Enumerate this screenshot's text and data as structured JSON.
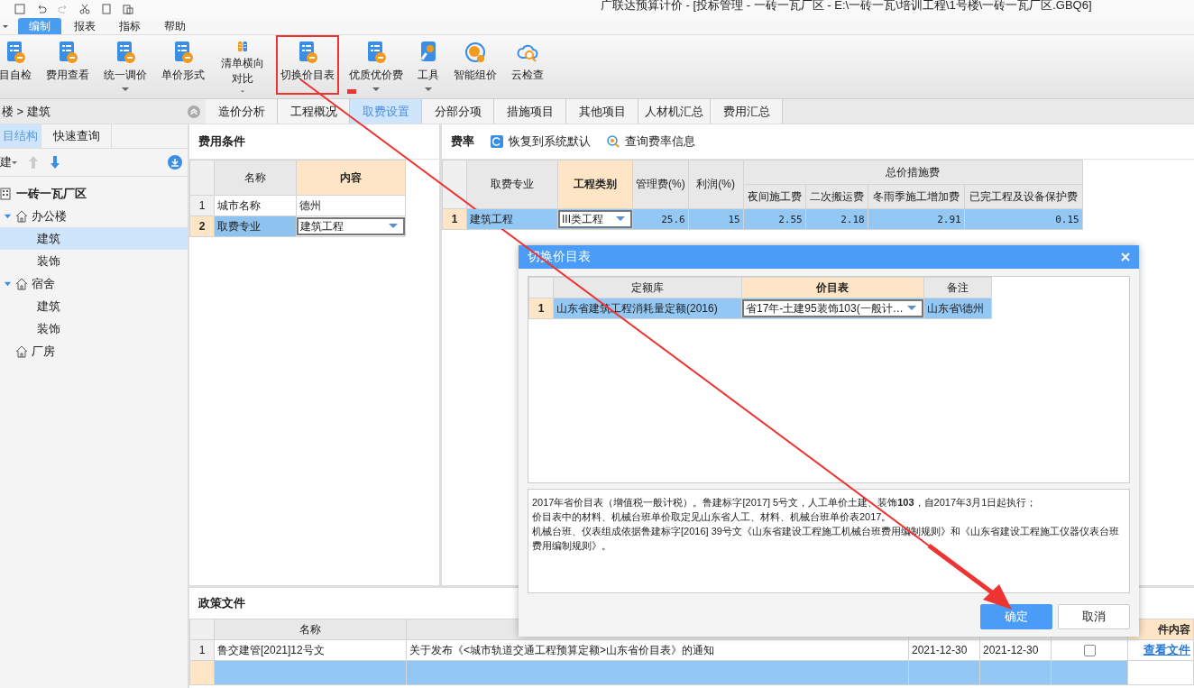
{
  "title_bar": {
    "title": "广联达预算计价 - [投标管理 - 一砖一瓦厂区 - E:\\一砖一瓦\\培训工程\\1号楼\\一砖一瓦厂区.GBQ6]"
  },
  "menu_tabs": [
    {
      "label": "编制",
      "selected": true
    },
    {
      "label": "报表",
      "selected": false
    },
    {
      "label": "指标",
      "selected": false
    },
    {
      "label": "帮助",
      "selected": false
    }
  ],
  "ribbon": [
    {
      "label": "目自检",
      "dropdown": false,
      "highlighted": false
    },
    {
      "label": "费用查看",
      "dropdown": false,
      "highlighted": false
    },
    {
      "label": "统一调价",
      "dropdown": true,
      "highlighted": false
    },
    {
      "label": "单价形式",
      "dropdown": false,
      "highlighted": false
    },
    {
      "label": "清单横向对比",
      "dropdown": true,
      "highlighted": false
    },
    {
      "label": "切换价目表",
      "dropdown": false,
      "highlighted": true
    },
    {
      "label": "优质优价费",
      "dropdown": true,
      "highlighted": false
    },
    {
      "label": "工具",
      "dropdown": true,
      "highlighted": false
    },
    {
      "label": "智能组价",
      "dropdown": false,
      "highlighted": false
    },
    {
      "label": "云检查",
      "dropdown": false,
      "highlighted": false
    }
  ],
  "breadcrumb": "楼 > 建筑",
  "page_tabs": [
    {
      "label": "造价分析",
      "selected": false
    },
    {
      "label": "工程概况",
      "selected": false
    },
    {
      "label": "取费设置",
      "selected": true
    },
    {
      "label": "分部分项",
      "selected": false
    },
    {
      "label": "措施项目",
      "selected": false
    },
    {
      "label": "其他项目",
      "selected": false
    },
    {
      "label": "人材机汇总",
      "selected": false
    },
    {
      "label": "费用汇总",
      "selected": false
    }
  ],
  "sidebar": {
    "tabs": [
      {
        "label": "目结构",
        "selected": true
      },
      {
        "label": "快速查询",
        "selected": false
      }
    ],
    "new_button": "建",
    "tree": [
      {
        "label": "一砖一瓦厂区",
        "kind": "project",
        "selected": false,
        "children": [
          {
            "label": "办公楼",
            "kind": "building",
            "expanded": true,
            "selected": false,
            "children": [
              {
                "label": "建筑",
                "kind": "unit",
                "selected": true
              },
              {
                "label": "装饰",
                "kind": "unit",
                "selected": false
              }
            ]
          },
          {
            "label": "宿舍",
            "kind": "building",
            "expanded": true,
            "selected": false,
            "children": [
              {
                "label": "建筑",
                "kind": "unit",
                "selected": false
              },
              {
                "label": "装饰",
                "kind": "unit",
                "selected": false
              }
            ]
          },
          {
            "label": "厂房",
            "kind": "building",
            "selected": false
          }
        ]
      }
    ]
  },
  "fee_conditions": {
    "title": "费用条件",
    "columns": [
      "名称",
      "内容"
    ],
    "rows": [
      {
        "index": "1",
        "name": "城市名称",
        "value": "德州",
        "kind": "text",
        "selected": false
      },
      {
        "index": "2",
        "name": "取费专业",
        "value": "建筑工程",
        "kind": "dropdown",
        "selected": true
      }
    ]
  },
  "fee_rates": {
    "title": "费率",
    "actions": [
      "恢复到系统默认",
      "查询费率信息"
    ],
    "columns": {
      "specialty": "取费专业",
      "category": "工程类别",
      "management": "管理费(%)",
      "profit": "利润(%)",
      "group": "总价措施费",
      "night": "夜间施工费",
      "secondary": "二次搬运费",
      "winter": "冬雨季施工增加费",
      "protection": "已完工程及设备保护费"
    },
    "rows": [
      {
        "index": "1",
        "specialty": "建筑工程",
        "category": "III类工程",
        "management": "25.6",
        "profit": "15",
        "night": "2.55",
        "secondary": "2.18",
        "winter": "2.91",
        "protection": "0.15",
        "selected": true
      }
    ]
  },
  "policy_files": {
    "title": "政策文件",
    "columns": {
      "name": "名称",
      "file": "件内容"
    },
    "rows": [
      {
        "index": "1",
        "name": "鲁交建管[2021]12号文",
        "title": "关于发布《<城市轨道交通工程预算定额>山东省价目表》的通知",
        "date_1": "2021-12-30",
        "date_2": "2021-12-30",
        "checked": false,
        "link": "查看文件",
        "selected": false
      },
      {
        "selected": true
      }
    ]
  },
  "dialog": {
    "title": "切换价目表",
    "columns": [
      "定额库",
      "价目表",
      "备注"
    ],
    "rows": [
      {
        "index": "1",
        "library": "山东省建筑工程消耗量定额(2016)",
        "price_table": "省17年-土建95装饰103(一般计…",
        "note": "山东省\\德州",
        "selected": true
      }
    ],
    "description": [
      "2017年省价目表（增值税一般计税）。鲁建标字[2017] 5号文，人工单价土建、装饰**103**，自2017年3月1日起执行；",
      "价目表中的材料、机械台班单价取定见山东省人工、材料、机械台班单价表2017。",
      "机械台班、仪表组成依据鲁建标字[2016] 39号文《山东省建设工程施工机械台班费用编制规则》和《山东省建设工程施工仪器仪表台班费用编制规则》。"
    ],
    "buttons": [
      {
        "label": "确定",
        "primary": true
      },
      {
        "label": "取消",
        "primary": false
      }
    ]
  }
}
